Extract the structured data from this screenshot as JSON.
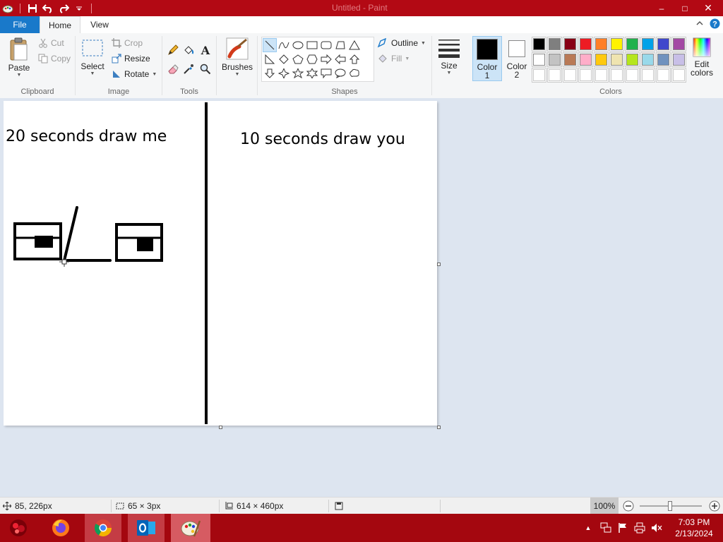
{
  "window": {
    "title": "Untitled - Paint"
  },
  "quick_access": {
    "icons": [
      "paint-app-icon",
      "save-icon",
      "undo-icon",
      "redo-icon",
      "customize-dropdown-icon"
    ]
  },
  "window_controls": {
    "minimize": "–",
    "maximize": "□",
    "close": "✕"
  },
  "tabs": [
    {
      "label": "File"
    },
    {
      "label": "Home"
    },
    {
      "label": "View"
    }
  ],
  "ribbon": {
    "help_icons": [
      "collapse-ribbon-icon",
      "help-icon"
    ],
    "clipboard": {
      "label": "Clipboard",
      "paste": "Paste",
      "cut": "Cut",
      "copy": "Copy"
    },
    "image": {
      "label": "Image",
      "select": "Select",
      "crop": "Crop",
      "resize": "Resize",
      "rotate": "Rotate"
    },
    "tools": {
      "label": "Tools",
      "icons": [
        "pencil-icon",
        "fill-icon",
        "text-icon",
        "eraser-icon",
        "color-picker-icon",
        "magnifier-icon"
      ],
      "text_glyph": "A"
    },
    "brushes": {
      "label": "Brushes"
    },
    "shapes": {
      "label": "Shapes",
      "outline": "Outline",
      "fill": "Fill"
    },
    "size": {
      "label": "Size"
    },
    "color1": {
      "label_line1": "Color",
      "label_line2": "1",
      "color": "#000000"
    },
    "color2": {
      "label_line1": "Color",
      "label_line2": "2",
      "color": "#ffffff"
    },
    "colors": {
      "label": "Colors",
      "row1": [
        "#000000",
        "#7f7f7f",
        "#880015",
        "#ed1c24",
        "#ff7f27",
        "#fff200",
        "#22b14c",
        "#00a2e8",
        "#3f48cc",
        "#a349a4"
      ],
      "row2": [
        "#ffffff",
        "#c3c3c3",
        "#b97a57",
        "#ffaec9",
        "#ffc90e",
        "#efe4b0",
        "#b5e61d",
        "#99d9ea",
        "#7092be",
        "#c8bfe7"
      ],
      "row3": [
        "#ffffff",
        "#ffffff",
        "#ffffff",
        "#ffffff",
        "#ffffff",
        "#ffffff",
        "#ffffff",
        "#ffffff",
        "#ffffff",
        "#ffffff"
      ]
    },
    "edit_colors": {
      "line1": "Edit",
      "line2": "colors"
    }
  },
  "canvas": {
    "left_text": "20 seconds draw me",
    "right_text": "10 seconds draw you"
  },
  "status": {
    "cursor_pos": "85, 226px",
    "selection_size": "65 × 3px",
    "image_size": "614 × 460px",
    "zoom": "100%"
  },
  "taskbar": {
    "apps": [
      "start-icon",
      "firefox-icon",
      "chrome-icon",
      "outlook-icon",
      "paint-icon"
    ],
    "tray_icons": [
      "show-hidden-icons-icon",
      "network-icon",
      "flag-icon",
      "printer-icon",
      "volume-muted-icon"
    ],
    "time": "7:03 PM",
    "date": "2/13/2024"
  }
}
